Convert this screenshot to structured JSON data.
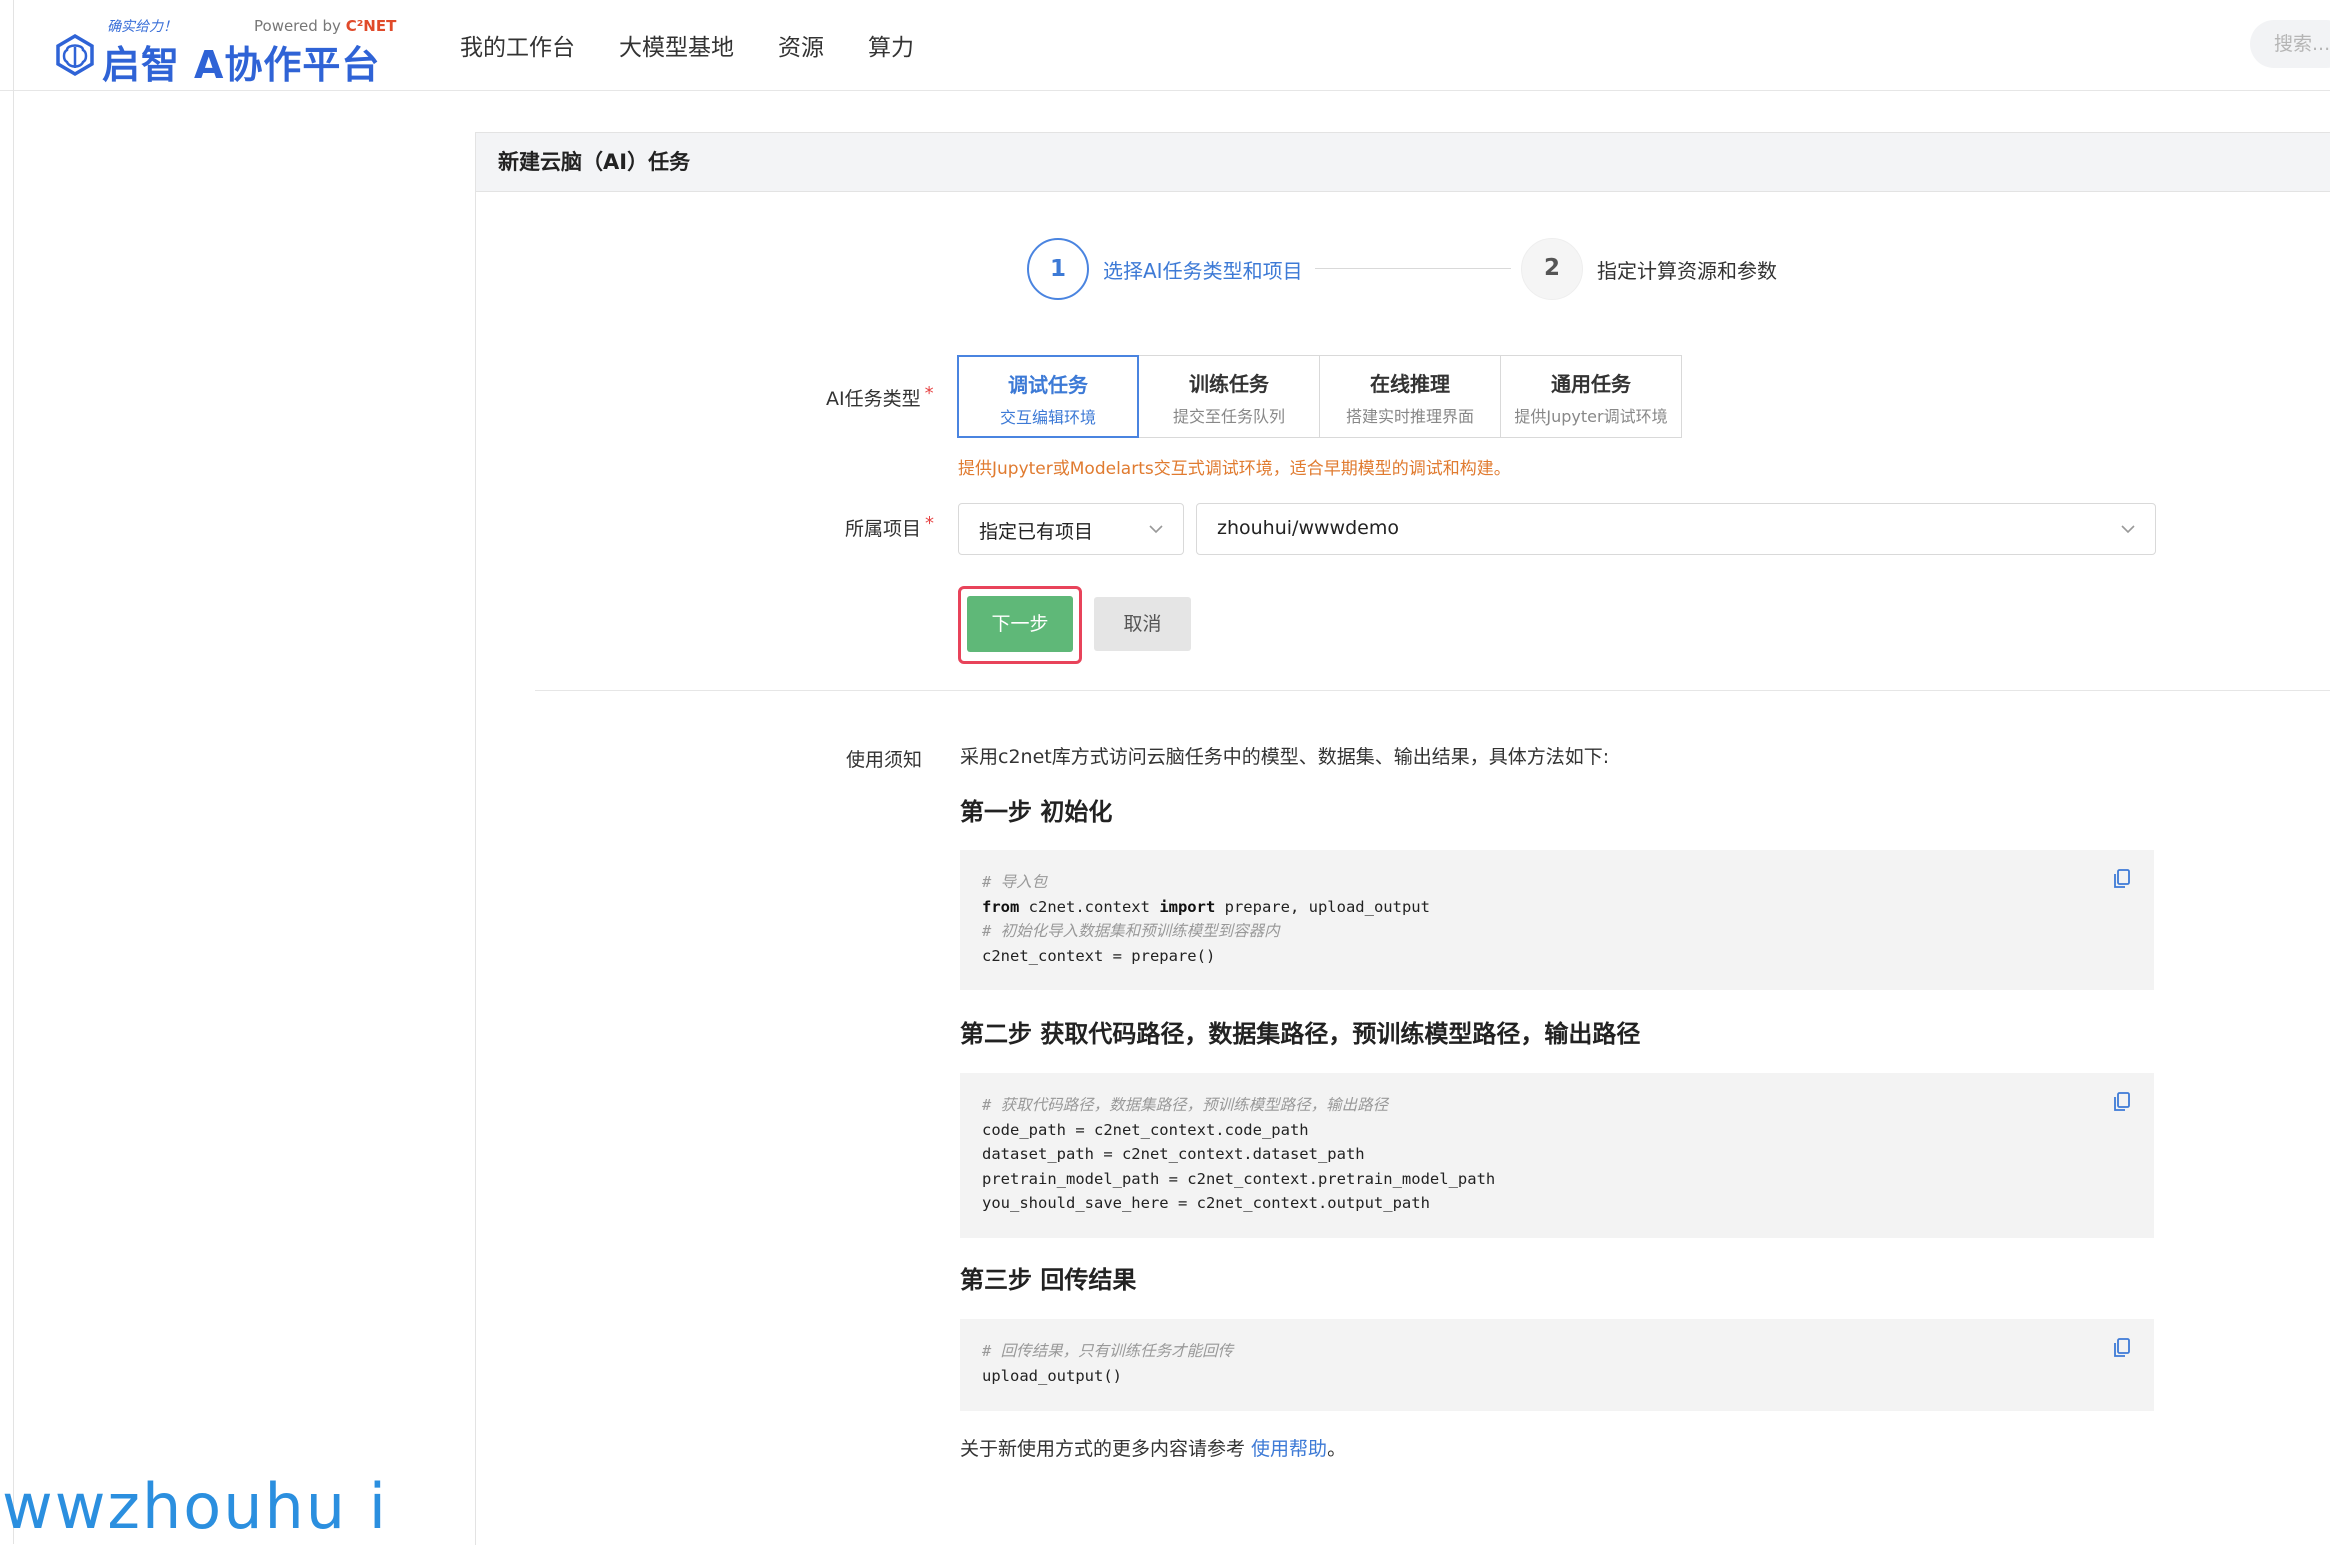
{
  "logo": {
    "slogan": "确实给力！",
    "powered_prefix": "Powered by ",
    "powered_brand": "C²NET",
    "name_part1": "启智",
    "name_part2": "A协作平台"
  },
  "nav": {
    "items": [
      "我的工作台",
      "大模型基地",
      "资源",
      "算力"
    ]
  },
  "search": {
    "placeholder": "搜索..."
  },
  "page": {
    "title": "新建云脑（AI）任务"
  },
  "steps": [
    {
      "number": "1",
      "label": "选择AI任务类型和项目"
    },
    {
      "number": "2",
      "label": "指定计算资源和参数"
    }
  ],
  "form": {
    "task_type_label": "AI任务类型",
    "required_mark": "*",
    "task_types": [
      {
        "title": "调试任务",
        "sub": "交互编辑环境"
      },
      {
        "title": "训练任务",
        "sub": "提交至任务队列"
      },
      {
        "title": "在线推理",
        "sub": "搭建实时推理界面"
      },
      {
        "title": "通用任务",
        "sub": "提供Jupyter调试环境"
      }
    ],
    "task_hint": "提供Jupyter或Modelarts交互式调试环境，适合早期模型的调试和构建。",
    "project_label": "所属项目",
    "project_mode": "指定已有项目",
    "project_value": "zhouhui/wwwdemo",
    "next_button": "下一步",
    "cancel_button": "取消"
  },
  "notice": {
    "label": "使用须知",
    "intro": "采用c2net库方式访问云脑任务中的模型、数据集、输出结果，具体方法如下:",
    "step1_title": "第一步 初始化",
    "step1_code": {
      "c1": "# 导入包",
      "l2_kw1": "from",
      "l2_mid": " c2net.context ",
      "l2_kw2": "import",
      "l2_end": " prepare, upload_output",
      "c3": "# 初始化导入数据集和预训练模型到容器内",
      "l4": "c2net_context = prepare()"
    },
    "step2_title": "第二步 获取代码路径，数据集路径，预训练模型路径，输出路径",
    "step2_code": {
      "c1": "# 获取代码路径，数据集路径，预训练模型路径，输出路径",
      "l2": "code_path = c2net_context.code_path",
      "l3": "dataset_path = c2net_context.dataset_path",
      "l4": "pretrain_model_path = c2net_context.pretrain_model_path",
      "l5": "you_should_save_here = c2net_context.output_path"
    },
    "step3_title": "第三步 回传结果",
    "step3_code": {
      "c1": "# 回传结果，只有训练任务才能回传",
      "l2": "upload_output()"
    },
    "footer_prefix": "关于新使用方式的更多内容请参考 ",
    "footer_link": "使用帮助",
    "footer_suffix": "。"
  },
  "watermark": "wwzhouhu i",
  "colors": {
    "primary": "#3d7ad6",
    "next_button": "#5fb878",
    "highlight_border": "#e8435a",
    "hint": "#e07b30"
  }
}
